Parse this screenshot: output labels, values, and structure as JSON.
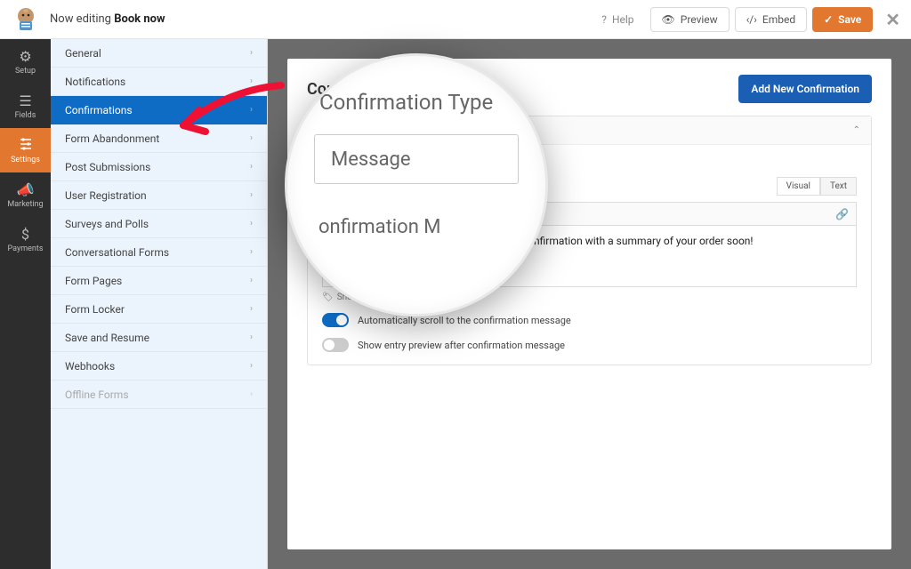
{
  "topbar": {
    "now_editing_prefix": "Now editing",
    "form_name": "Book now",
    "help": "Help",
    "preview": "Preview",
    "embed": "Embed",
    "save": "Save"
  },
  "leftnav": [
    {
      "icon": "⚙",
      "label": "Setup"
    },
    {
      "icon": "☰",
      "label": "Fields"
    },
    {
      "icon": "⚙",
      "label": "Settings",
      "active": true
    },
    {
      "icon": "📢",
      "label": "Marketing"
    },
    {
      "icon": "$",
      "label": "Payments"
    }
  ],
  "sidebar": [
    {
      "label": "General"
    },
    {
      "label": "Notifications"
    },
    {
      "label": "Confirmations",
      "active": true
    },
    {
      "label": "Form Abandonment"
    },
    {
      "label": "Post Submissions"
    },
    {
      "label": "User Registration"
    },
    {
      "label": "Surveys and Polls"
    },
    {
      "label": "Conversational Forms"
    },
    {
      "label": "Form Pages"
    },
    {
      "label": "Form Locker"
    },
    {
      "label": "Save and Resume"
    },
    {
      "label": "Webhooks"
    },
    {
      "label": "Offline Forms",
      "disabled": true
    }
  ],
  "page": {
    "title_visible": "Confimault Co",
    "add_button": "Add New Confirmation",
    "tabs": {
      "visual": "Visual",
      "text": "Text"
    },
    "editor_content": "l confirmation with a  summary of your order soon!",
    "smart_tags": "Show Smart Tags",
    "toggle1": "Automatically scroll to the confirmation message",
    "toggle2": "Show entry preview after confirmation message"
  },
  "lens": {
    "heading": "Confirmation Type",
    "value": "Message",
    "sub": "onfirmation M"
  }
}
